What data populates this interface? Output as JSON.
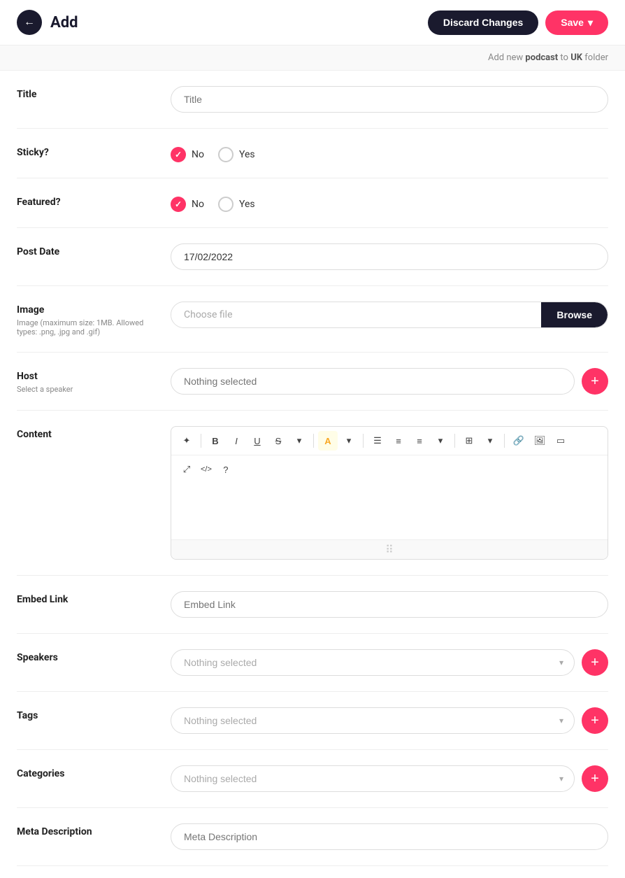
{
  "header": {
    "back_label": "←",
    "title": "Add",
    "discard_label": "Discard Changes",
    "save_label": "Save",
    "save_arrow": "▾"
  },
  "subheader": {
    "text_prefix": "Add new ",
    "bold1": "podcast",
    "text_middle": " to ",
    "bold2": "UK",
    "text_suffix": " folder"
  },
  "form": {
    "title_field": {
      "label": "Title",
      "placeholder": "Title"
    },
    "sticky_field": {
      "label": "Sticky?",
      "no_label": "No",
      "yes_label": "Yes"
    },
    "featured_field": {
      "label": "Featured?",
      "no_label": "No",
      "yes_label": "Yes"
    },
    "post_date_field": {
      "label": "Post Date",
      "value": "17/02/2022"
    },
    "image_field": {
      "label": "Image",
      "sublabel": "Image (maximum size: 1MB. Allowed types: .png, .jpg and .gif)",
      "choose_file_label": "Choose file",
      "browse_label": "Browse"
    },
    "host_field": {
      "label": "Host",
      "sublabel": "Select a speaker",
      "placeholder": "Nothing selected"
    },
    "content_field": {
      "label": "Content",
      "toolbar": {
        "magic": "✦",
        "bold": "B",
        "italic": "I",
        "underline": "U",
        "strikethrough": "S",
        "more1": "▾",
        "highlight": "A",
        "more2": "▾",
        "ul": "☰",
        "ol": "≡",
        "align": "≡",
        "align_more": "▾",
        "table": "⊞",
        "table_more": "▾",
        "link": "🔗",
        "image": "🖼",
        "media": "▭",
        "fullscreen": "⤢",
        "source": "</>",
        "help": "?"
      }
    },
    "embed_link_field": {
      "label": "Embed Link",
      "placeholder": "Embed Link"
    },
    "speakers_field": {
      "label": "Speakers",
      "placeholder": "Nothing selected"
    },
    "tags_field": {
      "label": "Tags",
      "placeholder": "Nothing selected"
    },
    "categories_field": {
      "label": "Categories",
      "placeholder": "Nothing selected"
    },
    "meta_description_field": {
      "label": "Meta Description",
      "placeholder": "Meta Description"
    }
  }
}
